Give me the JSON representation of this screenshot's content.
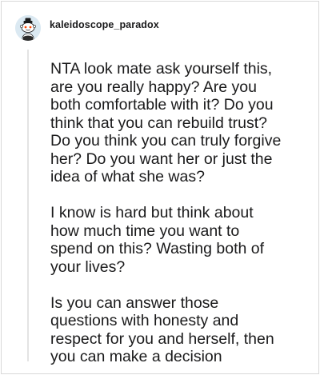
{
  "comment": {
    "author": "kaleidoscope_paradox",
    "paragraphs": [
      "NTA look mate ask yourself this,\nare you really happy? Are you\nboth comfortable with it? Do you\nthink that you can rebuild trust?\nDo you think you can truly forgive\nher? Do you want her or just the\nidea of what she was?",
      "I know is hard but think about\nhow much time you want to\nspend on this? Wasting both of\nyour lives?",
      "Is you can answer those\nquestions with honesty and\nrespect for you and herself, then\nyou can make a decision"
    ]
  },
  "colors": {
    "text": "#1a1a1b",
    "border": "#d9d9d9",
    "thread_line": "#e4e4e4",
    "avatar_bg": "#dbe9f2"
  },
  "icons": {
    "avatar": "reddit-snoo-avatar"
  }
}
